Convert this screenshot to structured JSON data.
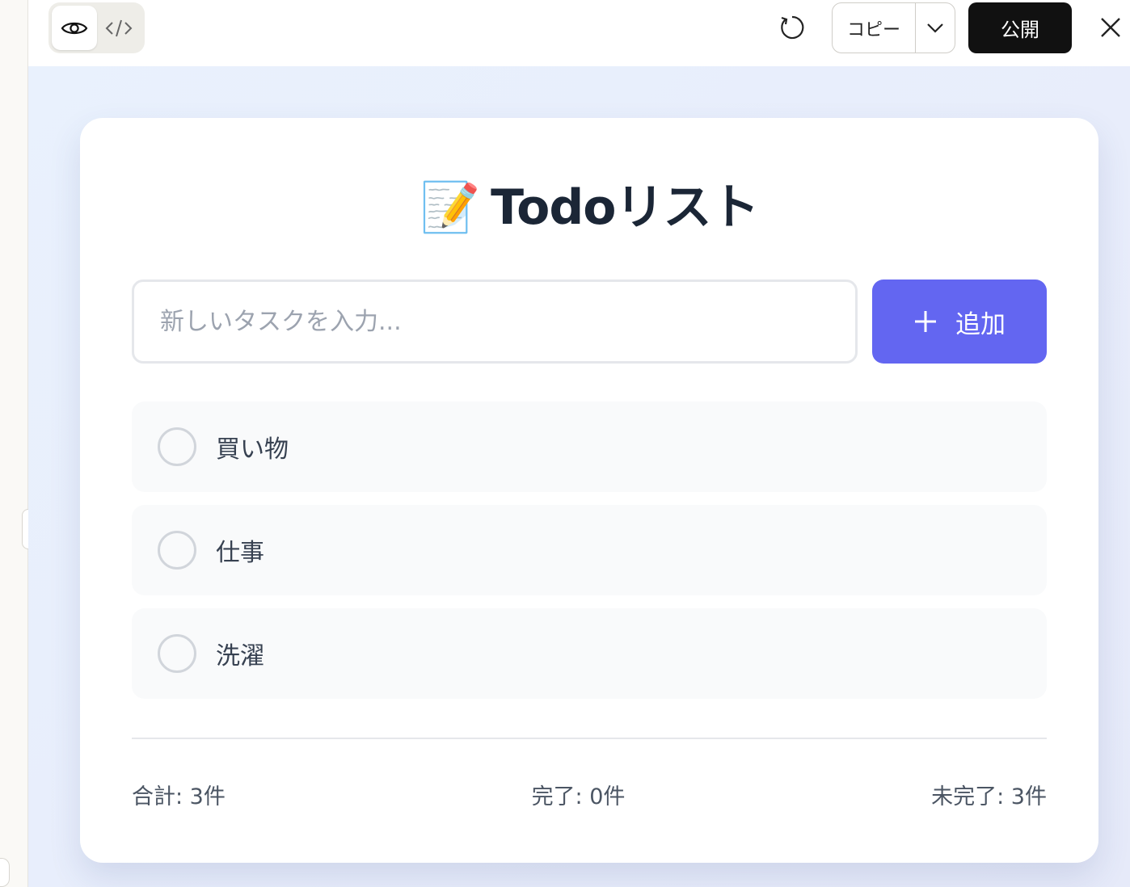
{
  "toolbar": {
    "copy_label": "コピー",
    "publish_label": "公開"
  },
  "app": {
    "title_emoji": "📝",
    "title_text": "Todoリスト",
    "input_placeholder": "新しいタスクを入力...",
    "add_button_label": "追加",
    "add_icon": "plus-icon",
    "accent_color": "#6366f1"
  },
  "todos": [
    {
      "text": "買い物",
      "done": false
    },
    {
      "text": "仕事",
      "done": false
    },
    {
      "text": "洗濯",
      "done": false
    }
  ],
  "stats": {
    "total": "合計: 3件",
    "done": "完了: 0件",
    "pending": "未完了: 3件"
  }
}
